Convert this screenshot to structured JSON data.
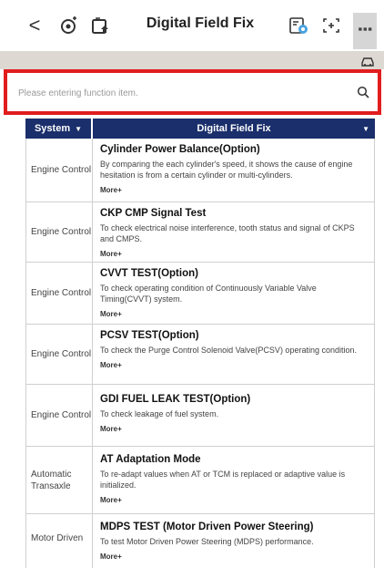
{
  "header": {
    "title": "Digital Field Fix",
    "back_label": "<"
  },
  "search": {
    "placeholder": "Please entering function item."
  },
  "table": {
    "col_system": "System",
    "col_dff": "Digital Field Fix"
  },
  "rows": [
    {
      "system": "Engine Control",
      "title": "Cylinder Power Balance(Option)",
      "desc": "By comparing the each cylinder's speed, it shows the cause of engine hesitation is from a certain cylinder or multi-cylinders.",
      "more": "More+"
    },
    {
      "system": "Engine Control",
      "title": "CKP CMP Signal Test",
      "desc": "To check electrical noise interference, tooth status and signal of CKPS and CMPS.",
      "more": "More+"
    },
    {
      "system": "Engine Control",
      "title": "CVVT TEST(Option)",
      "desc": "To check operating condition of Continuously Variable Valve Timing(CVVT) system.",
      "more": "More+"
    },
    {
      "system": "Engine Control",
      "title": "PCSV TEST(Option)",
      "desc": "To check the Purge Control Solenoid Valve(PCSV) operating condition.",
      "more": "More+"
    },
    {
      "system": "Engine Control",
      "title": "GDI FUEL LEAK TEST(Option)",
      "desc": "To check leakage of fuel system.",
      "more": "More+"
    },
    {
      "system": "Automatic Transaxle",
      "title": "AT Adaptation Mode",
      "desc": "To re-adapt values when AT or TCM is replaced or adaptive value is initialized.",
      "more": "More+"
    },
    {
      "system": "Motor Driven",
      "title": "MDPS TEST (Motor Driven Power Steering)",
      "desc": "To test Motor Driven Power Steering (MDPS) performance.",
      "more": "More+"
    }
  ],
  "colors": {
    "accent": "#1a2f6b",
    "highlight": "#e11d1d"
  }
}
